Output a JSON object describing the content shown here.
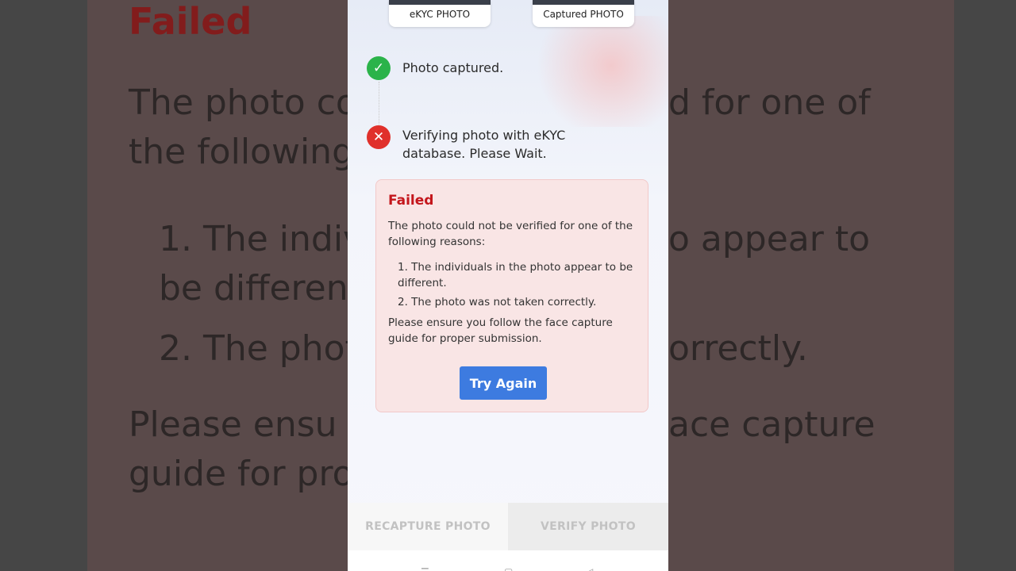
{
  "background": {
    "failed": "Failed",
    "line1": "The photo co",
    "line1b": "d for one of",
    "line2": "the following",
    "line3": "1. The indiv",
    "line3b": "o appear to",
    "line4": "be differen",
    "line5": "2. The phot",
    "line5b": "orrectly.",
    "line6": "Please ensu",
    "line6b": "ace capture",
    "line7": "guide for pro"
  },
  "photos": {
    "ekyc_label": "eKYC PHOTO",
    "captured_label": "Captured PHOTO"
  },
  "steps": {
    "captured": "Photo captured.",
    "verifying": "Verifying photo with eKYC database. Please Wait."
  },
  "failure": {
    "title": "Failed",
    "intro": "The photo could not be verified for one of the following reasons:",
    "reasons": [
      "1. The individuals in the photo appear to be different.",
      "2. The photo was not taken correctly."
    ],
    "advice": "Please ensure you follow the face capture guide for proper submission.",
    "button": "Try Again"
  },
  "actions": {
    "recapture": "RECAPTURE PHOTO",
    "verify": "VERIFY PHOTO"
  },
  "icons": {
    "success": "check-icon",
    "error": "close-icon"
  },
  "colors": {
    "success": "#2bb34a",
    "error": "#e0302b",
    "button": "#3d7be0"
  }
}
